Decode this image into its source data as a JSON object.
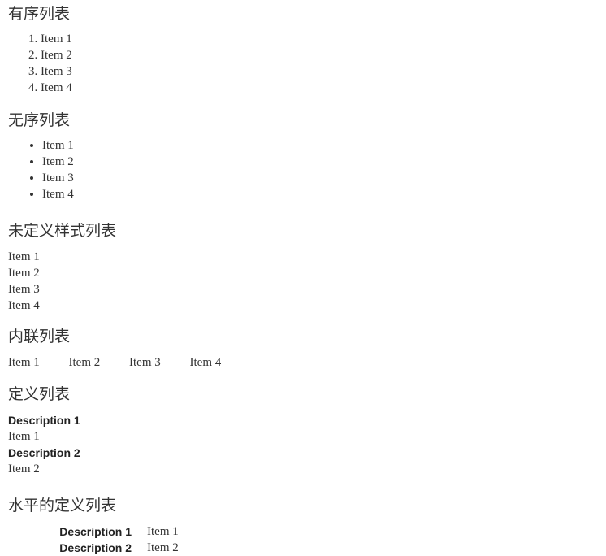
{
  "page": {
    "background": "#ffffff",
    "text_color": "#333333",
    "term_color": "#222222"
  },
  "sections": [
    {
      "id": "ordered-list",
      "heading": "有序列表",
      "type": "ordered",
      "items": [
        "Item 1",
        "Item 2",
        "Item 3",
        "Item 4"
      ]
    },
    {
      "id": "unordered-list",
      "heading": "无序列表",
      "type": "unordered",
      "items": [
        "Item 1",
        "Item 2",
        "Item 3",
        "Item 4"
      ]
    },
    {
      "id": "unstyled-list",
      "heading": "未定义样式列表",
      "type": "unstyled",
      "items": [
        "Item 1",
        "Item 2",
        "Item 3",
        "Item 4"
      ]
    },
    {
      "id": "inline-list",
      "heading": "内联列表",
      "type": "inline",
      "items": [
        "Item 1",
        "Item 2",
        "Item 3",
        "Item 4"
      ]
    },
    {
      "id": "definition-list",
      "heading": "定义列表",
      "type": "definition",
      "pairs": [
        {
          "term": "Description 1",
          "description": "Item 1"
        },
        {
          "term": "Description 2",
          "description": "Item 2"
        }
      ]
    },
    {
      "id": "horizontal-definition-list",
      "heading": "水平的定义列表",
      "type": "definition-horizontal",
      "pairs": [
        {
          "term": "Description 1",
          "description": "Item 1"
        },
        {
          "term": "Description 2",
          "description": "Item 2"
        }
      ]
    }
  ]
}
